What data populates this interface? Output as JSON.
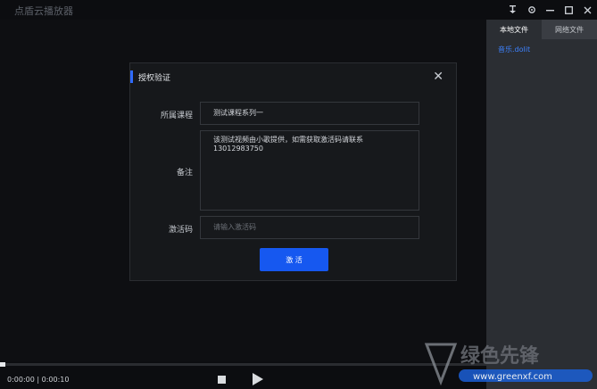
{
  "app": {
    "title": "点盾云播放器"
  },
  "window_controls": [
    "pin-icon",
    "gear-icon",
    "minimize-icon",
    "maximize-icon",
    "close-icon"
  ],
  "side_panel": {
    "tabs": [
      {
        "label": "本地文件",
        "active": true
      },
      {
        "label": "网络文件",
        "active": false
      }
    ],
    "files": [
      "音乐.dolit"
    ]
  },
  "modal": {
    "title": "授权验证",
    "fields": {
      "course_label": "所属课程",
      "course_value": "测试课程系列一",
      "note_label": "备注",
      "note_value": "该测试视频由小歌提供，如需获取激活码请联系13012983750",
      "code_label": "激活码",
      "code_placeholder": "请输入激活码"
    },
    "activate_label": "激 活"
  },
  "player": {
    "timecode": "0:00:00 | 0:00:10",
    "progress": 0.0
  },
  "watermark": {
    "site": "www.greenxf.com",
    "logo_text": "绿色先锋"
  },
  "colors": {
    "accent": "#1658f0",
    "link": "#3d82ff",
    "background": "#0e0f12"
  }
}
